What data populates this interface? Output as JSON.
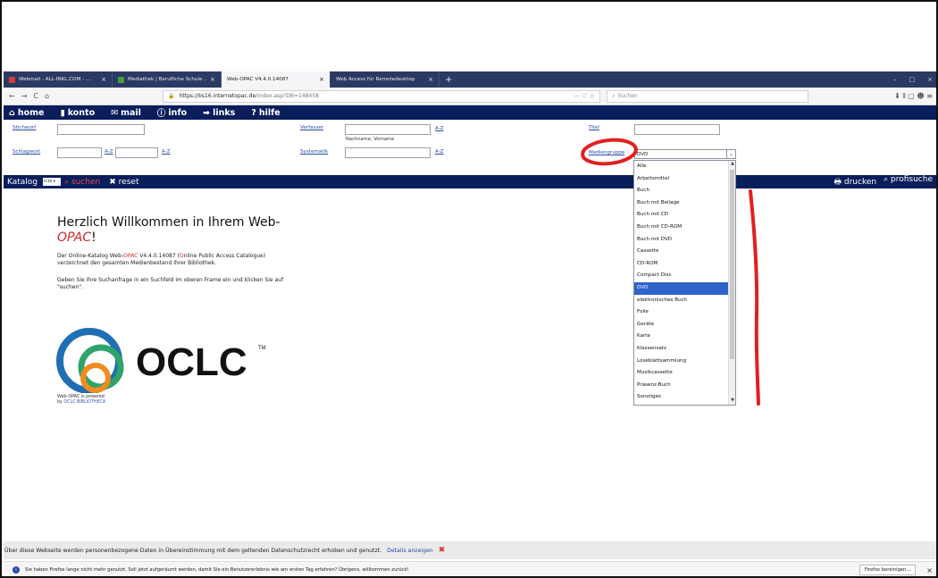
{
  "tabs": [
    {
      "label": "Webmail - ALL-INKL.COM - ...",
      "close": "×",
      "color": "#d83b3b"
    },
    {
      "label": "Mediathek | Berufliche Schule ...",
      "close": "×",
      "color": "#43a047"
    },
    {
      "label": "Web-OPAC V4.4.0.14087",
      "close": "×",
      "color": "#ffffff",
      "active": true
    },
    {
      "label": "Web Access für Remotedesktop",
      "close": "×",
      "color": "#2b3a63"
    }
  ],
  "newtab": "+",
  "window_controls": {
    "min": "–",
    "max": "□",
    "close": "×"
  },
  "nav": {
    "back": "←",
    "forward": "→",
    "reload": "C",
    "home_icon": "⌂",
    "url_host": "https://bs16.internetopac.de",
    "url_path": "/index.asp?DB=148458",
    "url_more": "··· ♡ ☆",
    "search_placeholder": "Suchen",
    "right_icons": "⬇  ⫴  ▢  ☻  ≡"
  },
  "opac_menu": [
    {
      "icon": "⌂",
      "label": "home"
    },
    {
      "icon": "▮",
      "label": "konto"
    },
    {
      "icon": "✉",
      "label": "mail"
    },
    {
      "icon": "ⓘ",
      "label": "info"
    },
    {
      "icon": "➡",
      "label": "links"
    },
    {
      "icon": "?",
      "label": "hilfe"
    }
  ],
  "form": {
    "stichwort": "Stichwort",
    "schlagwort": "Schlagwort",
    "verfasser": "Verfasser",
    "verfasser_hint": "Nachname, Vorname",
    "systematik": "Systematik",
    "titel": "Titel",
    "medien": "Mediengruppe",
    "az": "A-Z",
    "medien_value": "DVD",
    "arrow": "⌄"
  },
  "catalog_bar": {
    "katalog": "Katalog",
    "mini": "H38 ▾",
    "suchen": "suchen",
    "suchen_icon": "⌕",
    "reset": "reset",
    "reset_icon": "✖",
    "drucken": "drucken",
    "drucken_icon": "🖶",
    "profisuche": "profisuche",
    "profisuche_icon": "⌕"
  },
  "welcome": {
    "line1": "Herzlich Willkommen in Ihrem Web-",
    "opac": "OPAC",
    "excl": "!"
  },
  "para1": {
    "a": "Der Online-Katalog Web-",
    "opac": "OPAC",
    "b": " V4.4.0.14087 (",
    "o": "O",
    "c": "nline Public Access Catalogue) verzeichnet den gesamten Medienbestand Ihrer Bibliothek."
  },
  "para2": "Geben Sie Ihre Suchanfrage in ein Suchfeld im oberen Frame ein und klicken Sie auf \"suchen\".",
  "logo": {
    "text": "OCLC",
    "tm": "TM",
    "powered1": "Web-OPAC is powered",
    "powered2_pre": "by ",
    "powered2": "OCLC BIBLIOTHECA"
  },
  "dropdown_items": [
    "Alle",
    "Arbeitsmittel",
    "Buch",
    "Buch mit Beilage",
    "Buch mit CD",
    "Buch mit CD-ROM",
    "Buch mit DVD",
    "Cassette",
    "CD-ROM",
    "Compact Disc",
    "DVD",
    "elektronisches Buch",
    "Folie",
    "Geräte",
    "Karte",
    "Klassensatz",
    "Loseblattsammlung",
    "Musikcassette",
    "Präsenz-Buch",
    "Sonstiges"
  ],
  "dropdown_selected": "DVD",
  "privacy": {
    "text": "Über diese Webseite werden personenbezogene Daten in Übereinstimmung mit dem geltenden Datenschutzrecht erhoben und genutzt.",
    "link": "Details anzeigen",
    "x": "✖"
  },
  "notification": {
    "text": "Sie haben Firefox lange nicht mehr genutzt. Soll jetzt aufgeräumt werden, damit Sie ein Benutzererlebnis wie am ersten Tag erfahren? Übrigens, willkommen zurück!",
    "button": "Firefox bereinigen...",
    "close": "×",
    "icon": "i"
  },
  "colors": {
    "navy": "#0a1e5c",
    "annotation_red": "#e0201f",
    "selected_blue": "#2f63c9"
  }
}
